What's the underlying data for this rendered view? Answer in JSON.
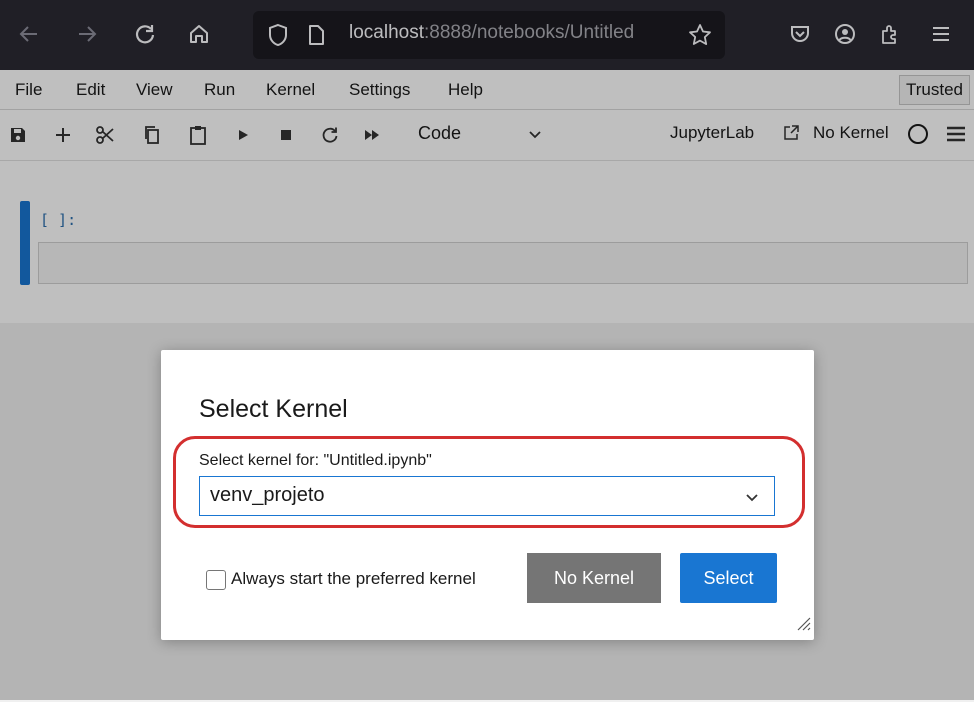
{
  "browser": {
    "url_host": "localhost",
    "url_rest": ":8888/notebooks/Untitled",
    "icons": [
      "back-icon",
      "forward-icon",
      "reload-icon",
      "home-icon",
      "shield-icon",
      "page-icon",
      "bookmark-star-icon",
      "pocket-icon",
      "account-icon",
      "extensions-icon",
      "app-menu-icon"
    ]
  },
  "menubar": {
    "items": [
      "File",
      "Edit",
      "View",
      "Run",
      "Kernel",
      "Settings",
      "Help"
    ],
    "trusted": "Trusted"
  },
  "toolbar": {
    "cell_type": "Code",
    "jupyterlab_link": "JupyterLab",
    "kernel_name": "No Kernel"
  },
  "cell": {
    "prompt": "[ ]:"
  },
  "dialog": {
    "title": "Select Kernel",
    "label": "Select kernel for: \"Untitled.ipynb\"",
    "selected_kernel": "venv_projeto",
    "checkbox_label": "Always start the preferred kernel",
    "checkbox_checked": false,
    "no_kernel_button": "No Kernel",
    "select_button": "Select",
    "highlight_color": "#d32f2f"
  },
  "colors": {
    "accent": "#1976d2",
    "browser_bar": "#2b2a33"
  }
}
